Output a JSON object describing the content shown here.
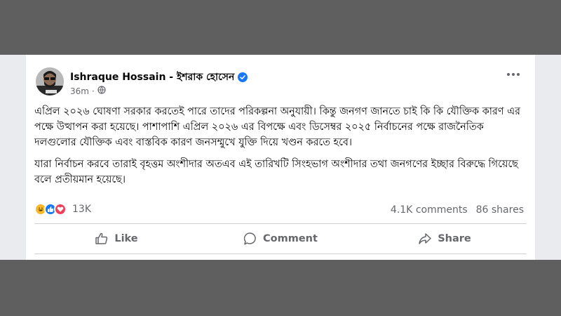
{
  "post": {
    "author": "Ishraque Hossain - ইশরাক হোসেন",
    "time": "36m",
    "dot": "·",
    "paragraphs": [
      "এপ্রিল ২০২৬ ঘোষণা সরকার করতেই পারে তাদের পরিকল্পনা অনুযায়ী। কিন্তু জনগণ জানতে চাই কি কি যৌক্তিক কারণ এর পক্ষে উত্থাপন করা হয়েছে। পাশাপাশি এপ্রিল ২০২৬ এর বিপক্ষে এবং ডিসেম্বর ২০২৫ নির্বাচনের পক্ষে রাজনৈতিক দলগুলোর যৌক্তিক এবং বাস্তবিক কারণ জনসম্মুখে যুক্তি দিয়ে খণ্ডন করতে হবে।",
      "যারা নির্বাচন করবে তারাই বৃহত্তম অংশীদার অতএব এই তারিখটি সিংহভাগ অংশীদার তথা জনগণের ইচ্ছার বিরুদ্ধে গিয়েছে বলে প্রতীয়মান হয়েছে।"
    ],
    "reaction_count": "13K",
    "comments": "4.1K comments",
    "shares": "86 shares",
    "icons": {
      "verified": "verified-badge-icon",
      "privacy": "globe-icon",
      "more": "more-options-icon",
      "reactions": [
        "haha-reaction-icon",
        "like-reaction-icon",
        "love-reaction-icon"
      ]
    }
  },
  "actions": {
    "like": "Like",
    "comment": "Comment",
    "share": "Share"
  },
  "colors": {
    "accent": "#1877f2",
    "text": "#050505",
    "muted": "#65676b",
    "overlay": "#5f5f5f"
  }
}
